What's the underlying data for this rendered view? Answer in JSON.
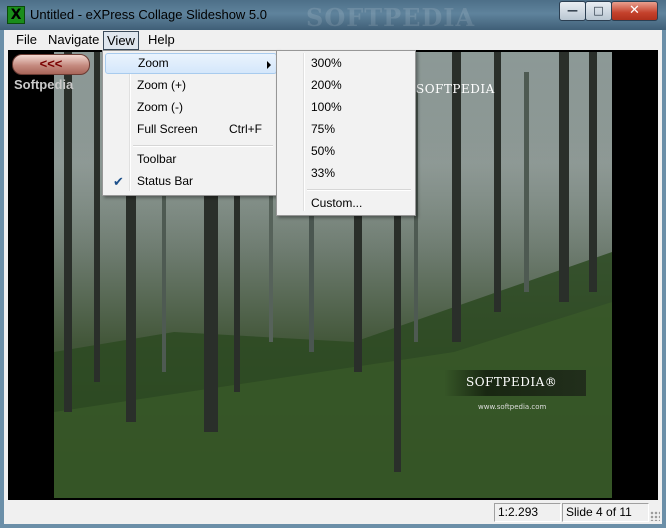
{
  "window": {
    "title": "Untitled - eXPress Collage Slideshow 5.0",
    "icon": "app-x-icon",
    "controls": {
      "minimize": "—",
      "maximize": "□",
      "close": "✕"
    }
  },
  "menubar": {
    "items": [
      "File",
      "Navigate",
      "View",
      "Help"
    ],
    "open_item": "View"
  },
  "view_menu": {
    "items": [
      {
        "label": "Zoom",
        "submenu": true,
        "highlighted": true
      },
      {
        "label": "Zoom (+)"
      },
      {
        "label": "Zoom (-)"
      },
      {
        "label": "Full Screen",
        "shortcut": "Ctrl+F"
      },
      {
        "label": "Toolbar"
      },
      {
        "label": "Status Bar",
        "checked": true
      }
    ]
  },
  "zoom_menu": {
    "items": [
      "300%",
      "200%",
      "100%",
      "75%",
      "50%",
      "33%",
      "Custom..."
    ]
  },
  "toolbar": {
    "back_label": "<<<"
  },
  "watermarks": {
    "titlebar_ghost": "SOFTPEDIA",
    "side": "Softpedia",
    "photo_top": "SOFTPEDIA",
    "photo_bottom": "SOFTPEDIA",
    "photo_bottom_symbol": "®",
    "photo_url": "www.softpedia.com"
  },
  "statusbar": {
    "ratio": "1:2.293",
    "slide": "Slide 4 of 11"
  },
  "colors": {
    "titlebar": "#5f839c",
    "close_button": "#c4412c",
    "back_button_text": "#7a0000",
    "menu_highlight": "#d4e7fb"
  }
}
